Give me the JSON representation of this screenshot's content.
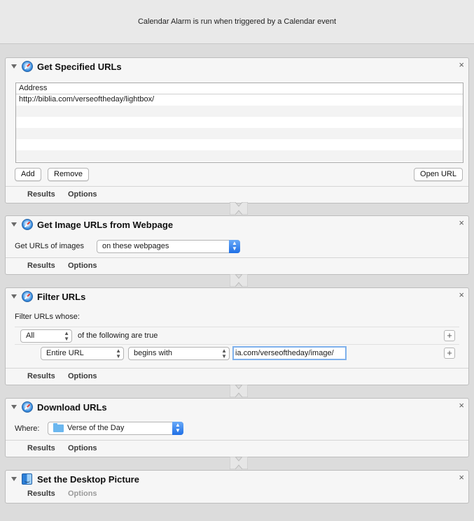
{
  "header": {
    "text": "Calendar Alarm is run when triggered by a Calendar event"
  },
  "tabs": {
    "results": "Results",
    "options": "Options"
  },
  "close_glyph": "×",
  "actions": {
    "get_specified_urls": {
      "title": "Get Specified URLs",
      "icon": "safari-icon",
      "column_header": "Address",
      "rows": [
        "http://biblia.com/verseoftheday/lightbox/"
      ],
      "add_label": "Add",
      "remove_label": "Remove",
      "open_url_label": "Open URL"
    },
    "get_image_urls": {
      "title": "Get Image URLs from Webpage",
      "icon": "safari-icon",
      "label": "Get URLs of images",
      "popup_value": "on these webpages"
    },
    "filter_urls": {
      "title": "Filter URLs",
      "icon": "safari-icon",
      "whose_label": "Filter URLs whose:",
      "quantifier": "All",
      "following_label": "of the following are true",
      "field_popup": "Entire URL",
      "operator_popup": "begins with",
      "value": "ia.com/verseoftheday/image/"
    },
    "download_urls": {
      "title": "Download URLs",
      "icon": "safari-icon",
      "where_label": "Where:",
      "folder": "Verse of the Day"
    },
    "set_desktop_picture": {
      "title": "Set the Desktop Picture",
      "icon": "finder-icon"
    }
  },
  "colors": {
    "accent": "#2f7ff0",
    "background": "#dcdcdc",
    "panel": "#f6f6f6"
  }
}
